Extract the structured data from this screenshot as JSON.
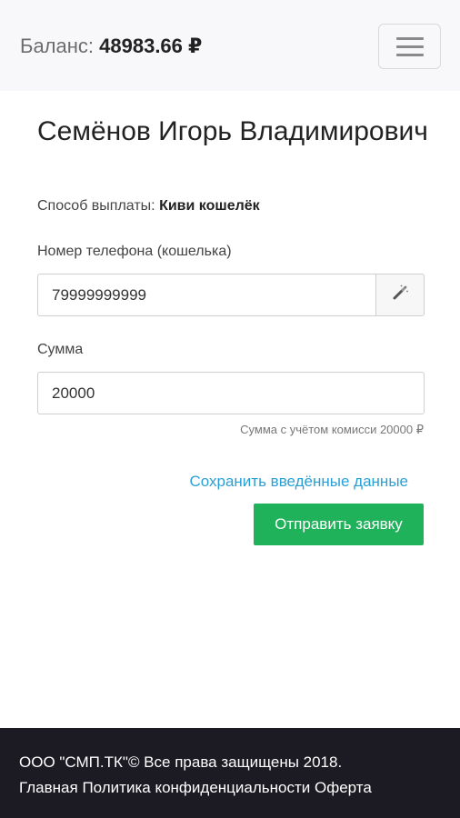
{
  "header": {
    "balance_label": "Баланс:",
    "balance_amount": "48983.66 ₽",
    "menu_icon": "hamburger-icon"
  },
  "main": {
    "name": "Семёнов Игорь Владимирович",
    "method_label": "Способ выплаты:",
    "method_value": "Киви кошелёк",
    "phone_label": "Номер телефона (кошелька)",
    "phone_value": "79999999999",
    "wand_icon": "magic-wand-icon",
    "sum_label": "Сумма",
    "sum_value": "20000",
    "commission_hint": "Сумма с учётом комисси 20000 ₽",
    "save_link": "Сохранить введённые данные",
    "submit_label": "Отправить заявку"
  },
  "footer": {
    "copyright": "ООО \"СМП.ТК\"© Все права защищены 2018.",
    "links": [
      "Главная",
      "Политика конфиденциальности",
      "Оферта"
    ]
  },
  "colors": {
    "accent_link": "#2a9fd6",
    "submit_button": "#1fb25a",
    "footer_bg": "#1c1a22"
  }
}
